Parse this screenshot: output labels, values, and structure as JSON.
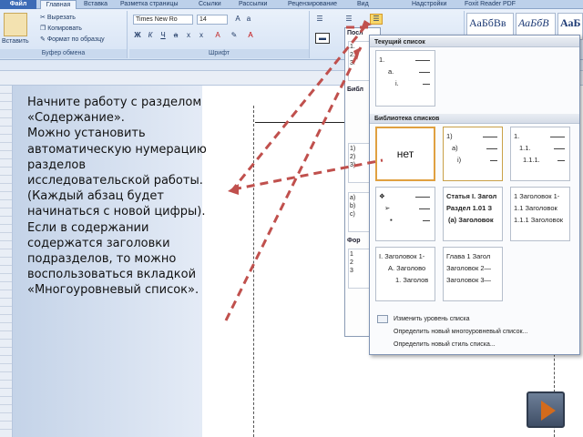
{
  "ribbon": {
    "tabs": [
      "Файл",
      "Главная",
      "Вставка",
      "Разметка страницы",
      "Ссылки",
      "Рассылки",
      "Рецензирование",
      "Вид",
      "Надстройки",
      "Foxit Reader PDF"
    ],
    "clipboard": {
      "paste": "Вставить",
      "cut": "Вырезать",
      "copy": "Копировать",
      "format_painter": "Формат по образцу",
      "group_label": "Буфер обмена"
    },
    "font": {
      "name": "Times New Ro",
      "size": "14",
      "group_label": "Шрифт"
    },
    "styles": [
      "АаБбВв",
      "АаБбВ",
      "АаБ"
    ]
  },
  "main_text": [
    "Начните работу с разделом «Содержание».",
    "Можно установить автоматическую нумерацию разделов исследовательской работы.",
    "(Каждый абзац будет начинаться с новой цифры).",
    "Если в содержании содержатся заголовки подразделов, то можно воспользоваться вкладкой «Многоуровневый список»."
  ],
  "popup": {
    "current_list_label": "Текущий список",
    "library_label": "Библиотека списков",
    "none_label": "нет",
    "current_list": [
      "1.",
      "a.",
      "i."
    ],
    "library": [
      [
        "1)",
        "a)",
        "i)"
      ],
      [
        "1.",
        "1.1.",
        "1.1.1."
      ],
      [
        "Статья I. Загол",
        "Раздел 1.01 З",
        "(a) Заголовок"
      ],
      [
        "1 Заголовок 1-",
        "1.1 Заголовок",
        "1.1.1 Заголовок"
      ],
      [
        "I. Заголовок 1-",
        "A. Заголово",
        "1. Заголов"
      ],
      [
        "Глава 1 Загол",
        "Заголовок 2—",
        "Заголовок 3—"
      ]
    ],
    "bullet_list": [
      "❖",
      "➢",
      "▪"
    ],
    "menu": [
      "Изменить уровень списка",
      "Определить новый многоуровневый список...",
      "Определить новый стиль списка..."
    ]
  },
  "small_panel": {
    "label_recent": "Посл",
    "label_lib": "Библ",
    "label_format": "Фор",
    "rows": [
      "1.",
      "2.",
      "3."
    ],
    "rows2": [
      "1)",
      "2)",
      "3)"
    ],
    "rows3": [
      "a)",
      "b)",
      "c)"
    ],
    "rows4": [
      "1",
      "2",
      "3"
    ]
  },
  "colors": {
    "arrow": "#c0504d",
    "accent": "#3c6bb6",
    "none_border": "#e0a040"
  }
}
